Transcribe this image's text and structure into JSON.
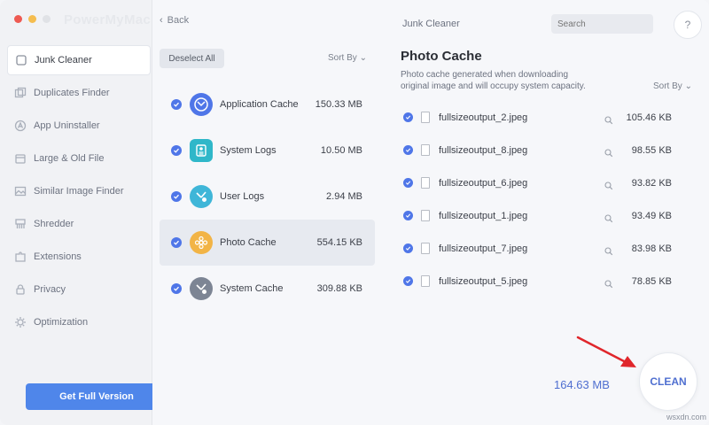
{
  "app": {
    "title": "PowerMyMac",
    "traffic_colors": [
      "#ee5a52",
      "#f5bd4f",
      "#e0e2e6"
    ]
  },
  "sidebar": {
    "items": [
      {
        "label": "Junk Cleaner",
        "icon": "junk-cleaner-icon",
        "active": true
      },
      {
        "label": "Duplicates Finder",
        "icon": "duplicates-icon"
      },
      {
        "label": "App Uninstaller",
        "icon": "app-uninstaller-icon"
      },
      {
        "label": "Large & Old File",
        "icon": "large-file-icon"
      },
      {
        "label": "Similar Image Finder",
        "icon": "image-icon"
      },
      {
        "label": "Shredder",
        "icon": "shredder-icon"
      },
      {
        "label": "Extensions",
        "icon": "extensions-icon"
      },
      {
        "label": "Privacy",
        "icon": "privacy-icon"
      },
      {
        "label": "Optimization",
        "icon": "optimization-icon"
      }
    ],
    "full_version_label": "Get Full Version"
  },
  "middle": {
    "back_label": "Back",
    "deselect_label": "Deselect All",
    "sort_label": "Sort By",
    "categories": [
      {
        "name": "Application Cache",
        "size": "150.33 MB",
        "icon": "application-cache-icon"
      },
      {
        "name": "System Logs",
        "size": "10.50 MB",
        "icon": "system-logs-icon"
      },
      {
        "name": "User Logs",
        "size": "2.94 MB",
        "icon": "user-logs-icon"
      },
      {
        "name": "Photo Cache",
        "size": "554.15 KB",
        "icon": "photo-cache-icon",
        "selected": true
      },
      {
        "name": "System Cache",
        "size": "309.88 KB",
        "icon": "system-cache-icon"
      }
    ]
  },
  "right": {
    "section_title": "Junk Cleaner",
    "search_placeholder": "Search",
    "help_label": "?",
    "detail_title": "Photo Cache",
    "detail_desc": "Photo cache generated when downloading original image and will occupy system capacity.",
    "sort_label": "Sort By",
    "files": [
      {
        "name": "fullsizeoutput_2.jpeg",
        "size": "105.46 KB"
      },
      {
        "name": "fullsizeoutput_8.jpeg",
        "size": "98.55 KB"
      },
      {
        "name": "fullsizeoutput_6.jpeg",
        "size": "93.82 KB"
      },
      {
        "name": "fullsizeoutput_1.jpeg",
        "size": "93.49 KB"
      },
      {
        "name": "fullsizeoutput_7.jpeg",
        "size": "83.98 KB"
      },
      {
        "name": "fullsizeoutput_5.jpeg",
        "size": "78.85 KB"
      }
    ],
    "total_size": "164.63 MB",
    "clean_label": "CLEAN"
  },
  "watermark": "wsxdn.com",
  "colors": {
    "accent": "#4f76e8",
    "arrow": "#e0262b"
  }
}
